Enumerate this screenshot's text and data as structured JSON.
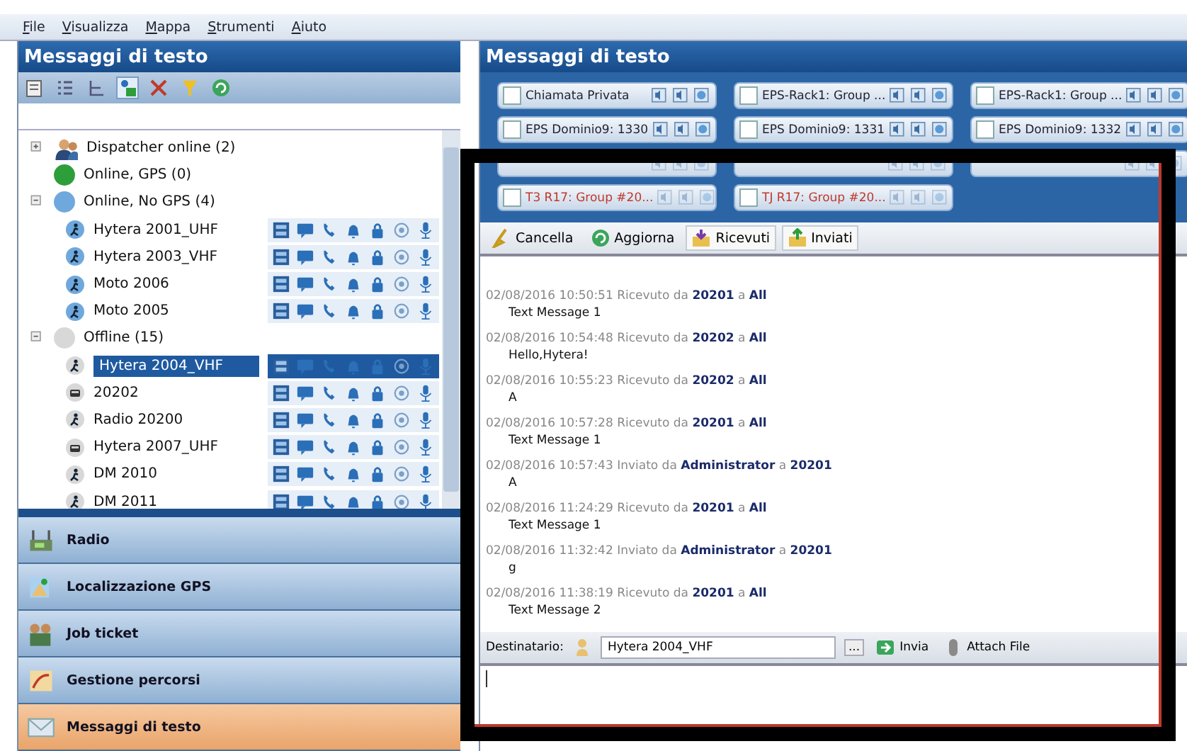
{
  "menu": [
    {
      "label": "File"
    },
    {
      "label": "Visualizza"
    },
    {
      "label": "Mappa"
    },
    {
      "label": "Strumenti"
    },
    {
      "label": "Aiuto"
    }
  ],
  "left_panel": {
    "title": "Messaggi di testo",
    "tree": [
      {
        "label": "Dispatcher online (2)",
        "kind": "dispatcher",
        "expanded": false
      },
      {
        "label": "Online, GPS (0)",
        "kind": "status",
        "color": "#2e9e3a"
      },
      {
        "label": "Online, No GPS (4)",
        "kind": "status",
        "color": "#6fa8dc",
        "expanded": true,
        "children": [
          {
            "label": "Hytera 2001_UHF",
            "kind": "person",
            "selected": false
          },
          {
            "label": "Hytera 2003_VHF",
            "kind": "person",
            "selected": false
          },
          {
            "label": "Moto 2006",
            "kind": "person",
            "selected": false
          },
          {
            "label": "Moto 2005",
            "kind": "person",
            "selected": false
          }
        ]
      },
      {
        "label": "Offline (15)",
        "kind": "status",
        "color": "#d8d8d8",
        "expanded": true,
        "children": [
          {
            "label": "Hytera 2004_VHF",
            "kind": "person",
            "selected": true
          },
          {
            "label": "20202",
            "kind": "car",
            "selected": false
          },
          {
            "label": "Radio 20200",
            "kind": "person",
            "selected": false
          },
          {
            "label": "Hytera 2007_UHF",
            "kind": "car",
            "selected": false
          },
          {
            "label": "DM 2010",
            "kind": "person",
            "selected": false
          },
          {
            "label": "DM 2011",
            "kind": "person",
            "selected": false
          }
        ]
      }
    ]
  },
  "nav": [
    {
      "label": "Radio",
      "selected": false
    },
    {
      "label": "Localizzazione GPS",
      "selected": false
    },
    {
      "label": "Job ticket",
      "selected": false
    },
    {
      "label": "Gestione percorsi",
      "selected": false
    },
    {
      "label": "Messaggi di testo",
      "selected": true
    }
  ],
  "right_panel": {
    "title": "Messaggi di testo",
    "channels": [
      {
        "label": "Chiamata Privata",
        "checked": false,
        "kind": "normal"
      },
      {
        "label": "EPS-Rack1: Group ...",
        "checked": false,
        "kind": "normal"
      },
      {
        "label": "EPS-Rack1: Group ...",
        "checked": false,
        "kind": "normal"
      },
      {
        "label": "EPS Dominio9: 1330",
        "checked": false,
        "kind": "normal"
      },
      {
        "label": "EPS Dominio9: 1331",
        "checked": false,
        "kind": "normal"
      },
      {
        "label": "EPS Dominio9: 1332",
        "checked": false,
        "kind": "normal"
      },
      {
        "kind": "offline"
      },
      {
        "kind": "offline"
      },
      {
        "kind": "offline"
      },
      {
        "label": "T3 R17: Group #20...",
        "checked": false,
        "kind": "offline"
      },
      {
        "label": "TJ R17: Group #20...",
        "checked": false,
        "kind": "offline"
      }
    ],
    "toolbar": [
      {
        "label": "Cancella"
      },
      {
        "label": "Aggiorna"
      },
      {
        "label": "Ricevuti"
      },
      {
        "label": "Inviati"
      }
    ],
    "messages": [
      {
        "header": "02/08/2016 10:50:51 Ricevuto da **20201** a **All**",
        "body": "Text Message 1"
      },
      {
        "header": "02/08/2016 10:54:48 Ricevuto da **20202** a **All**",
        "body": "Hello,Hytera!"
      },
      {
        "header": "02/08/2016 10:55:23 Ricevuto da **20202** a **All**",
        "body": "A"
      },
      {
        "header": "02/08/2016 10:57:28 Ricevuto da **20201** a **All**",
        "body": "Text Message 1"
      },
      {
        "header": "02/08/2016 10:57:43 Inviato da **Administrator** a **20201**",
        "body": "A"
      },
      {
        "header": "02/08/2016 11:24:29 Ricevuto da **20201** a **All**",
        "body": "Text Message 1"
      },
      {
        "header": "02/08/2016 11:32:42 Inviato da **Administrator** a **20201**",
        "body": "g"
      },
      {
        "header": "02/08/2016 11:38:19 Ricevuto da **20201** a **All**",
        "body": "Text Message 2"
      }
    ],
    "recipient": {
      "label": "Destinatario:",
      "value": "Hytera 2004_VHF",
      "browse": "...",
      "send": "Invia",
      "attach": "Attach File"
    }
  }
}
